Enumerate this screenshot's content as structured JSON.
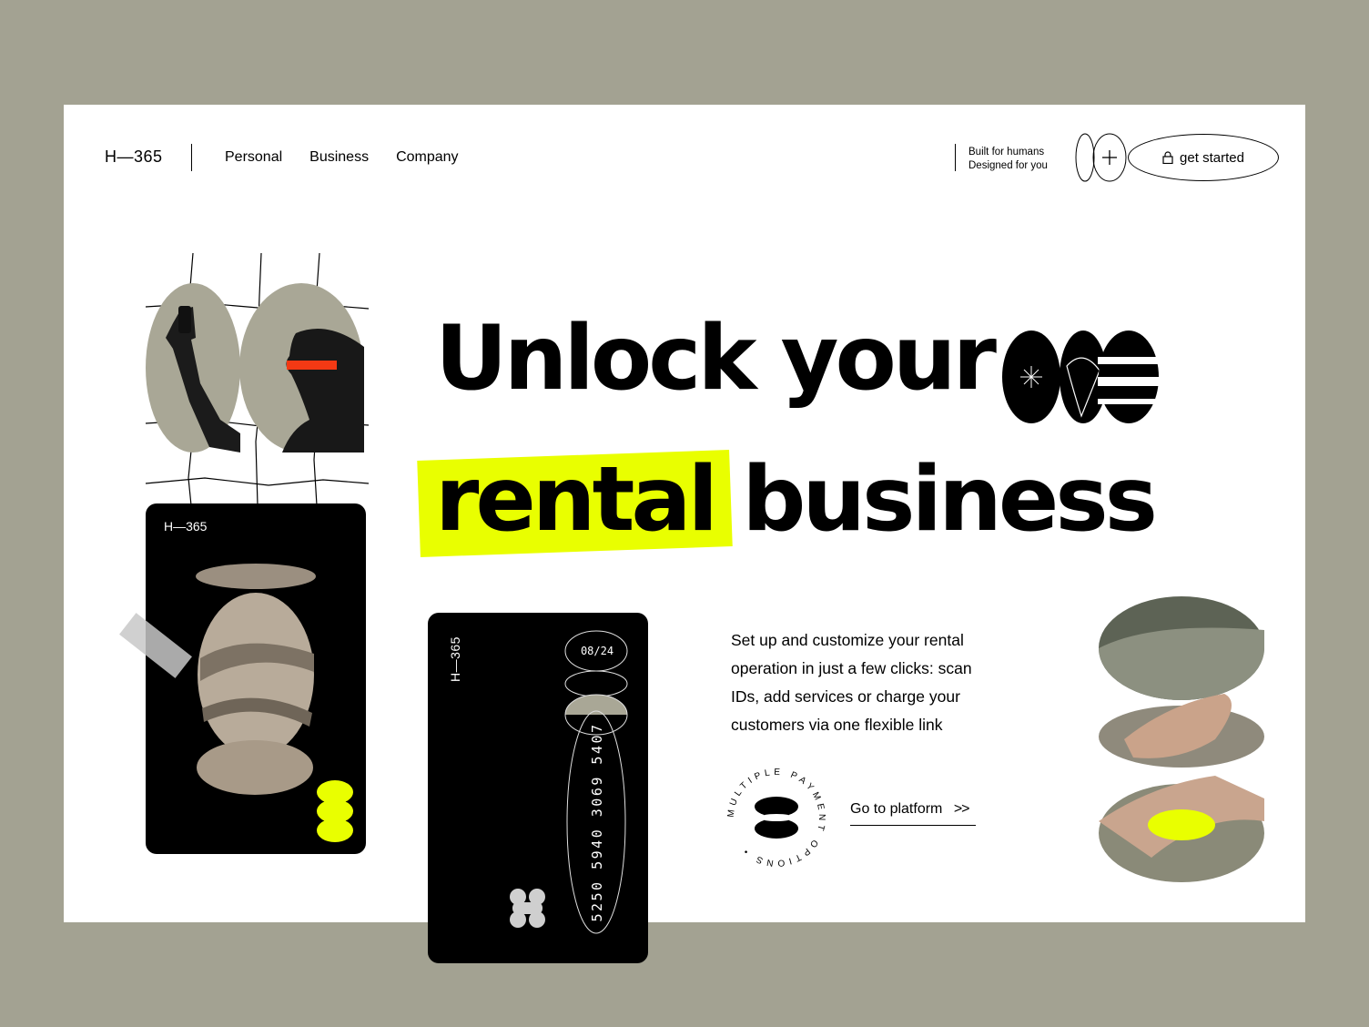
{
  "brand": {
    "logo": "H—365"
  },
  "nav": {
    "items": [
      "Personal",
      "Business",
      "Company"
    ]
  },
  "header": {
    "tagline_line1": "Built for humans",
    "tagline_line2": "Designed for you",
    "cta_label": "get started"
  },
  "hero": {
    "headline_line1": "Unlock your",
    "headline_highlight": "rental",
    "headline_line2_rest": "business",
    "description": "Set up and customize your rental operation in just a few clicks: scan IDs, add services or charge your customers via one flexible link",
    "link_label": "Go to platform",
    "badge_text": "MULTIPLE PAYMENT OPTIONS • "
  },
  "cards": {
    "left_brand": "H—365",
    "center_brand": "H—365",
    "expiry": "08/24",
    "card_number": "5250 5940 3069 5407"
  },
  "colors": {
    "background": "#a3a292",
    "panel": "#ffffff",
    "accent": "#e9ff00",
    "stone": "#a9a796"
  },
  "icons": [
    "plus-icon",
    "lock-icon",
    "chevron-right-icon",
    "star-icon"
  ]
}
